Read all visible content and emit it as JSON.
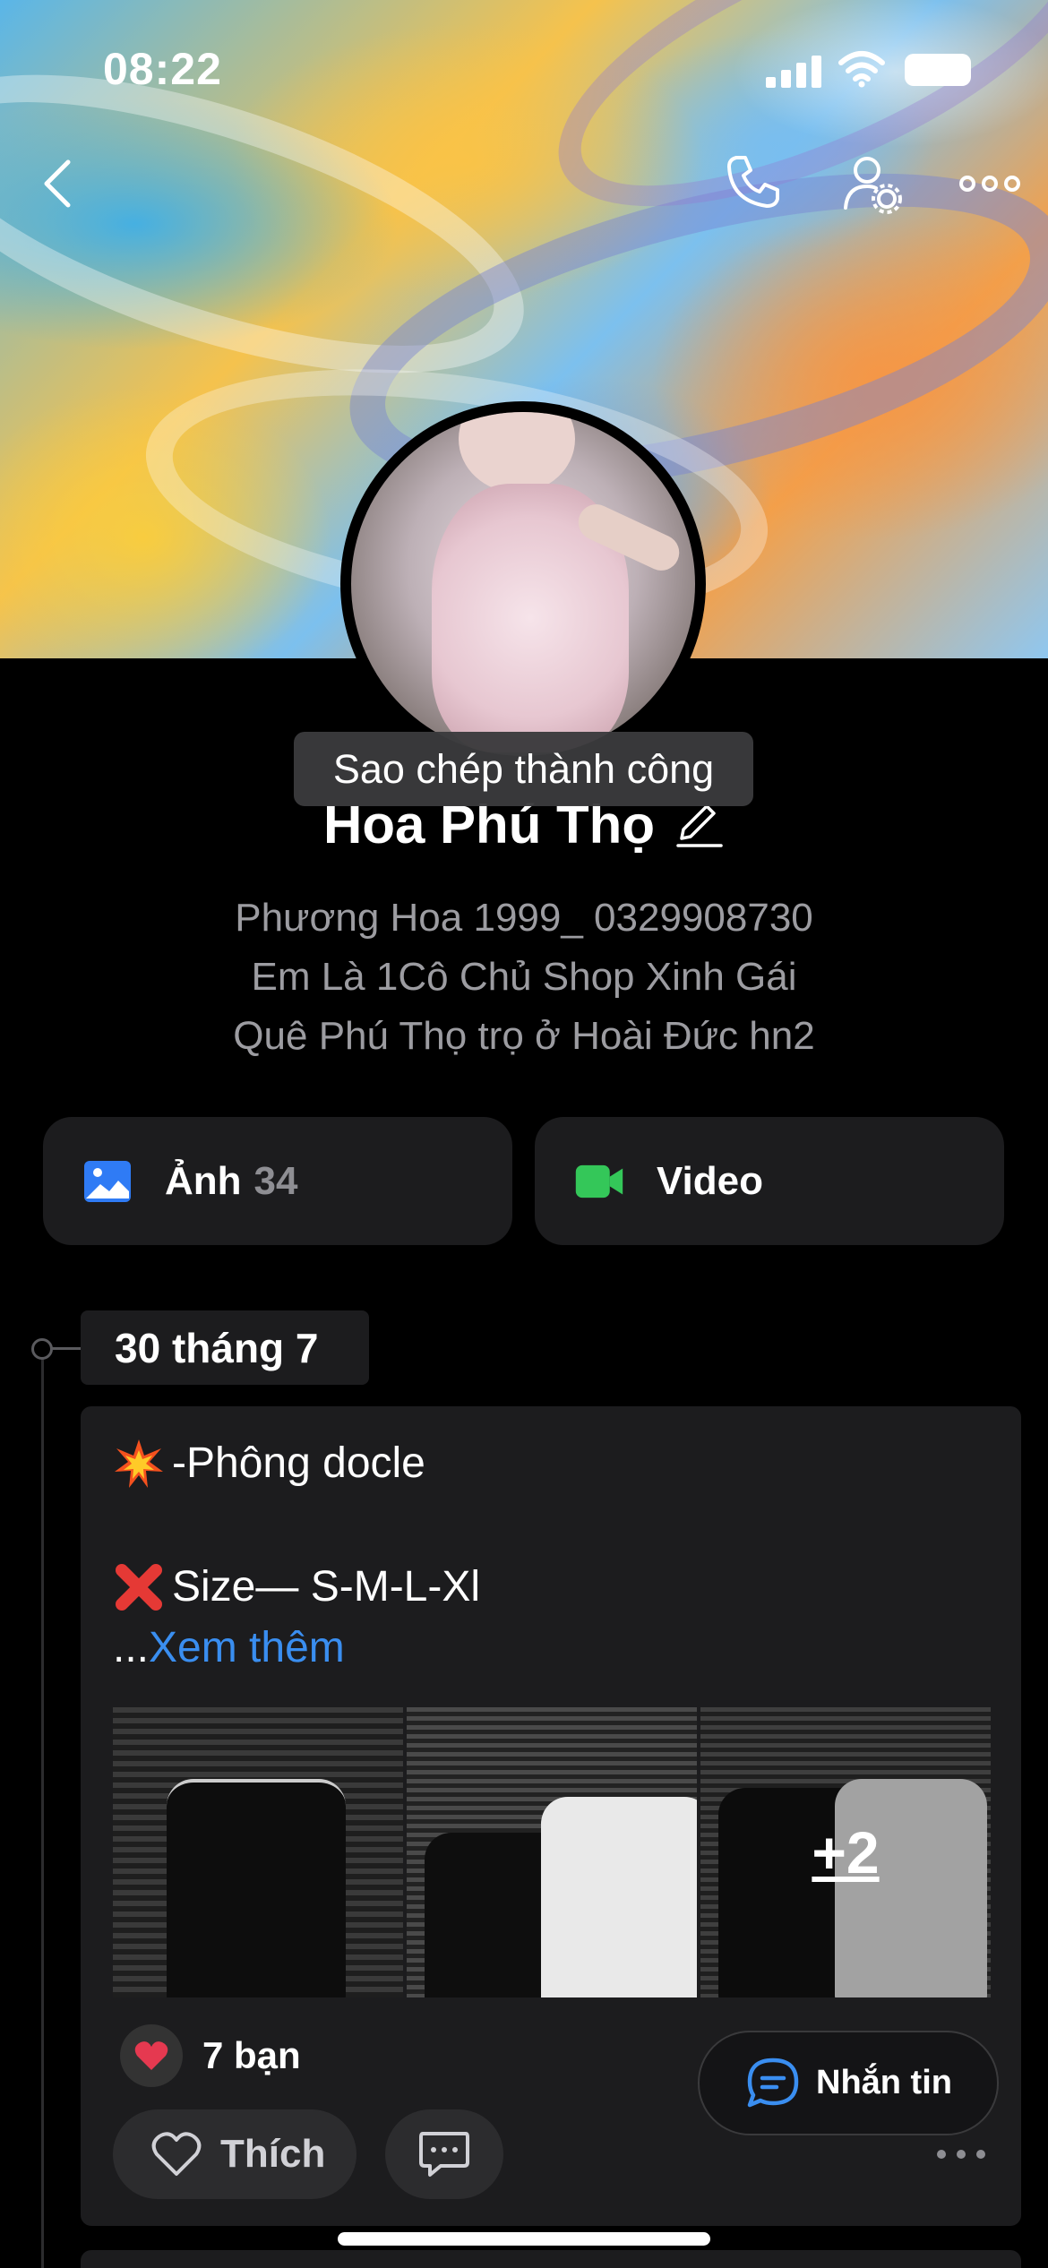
{
  "status_bar": {
    "time": "08:22"
  },
  "profile": {
    "name": "Hoa Phú Thọ",
    "bio": [
      "Phương Hoa 1999_ 0329908730",
      "Em Là 1Cô Chủ Shop Xinh Gái",
      "Quê Phú Thọ trọ ở Hoài Đức hn2"
    ]
  },
  "toast": {
    "text": "Sao chép thành công"
  },
  "media": {
    "photos_label": "Ảnh",
    "photos_count": "34",
    "videos_label": "Video"
  },
  "timeline": {
    "date": "30 tháng 7",
    "post": {
      "line1": "-Phông docle",
      "line2": "Size— S-M-L-Xl",
      "ellipsis": "...",
      "see_more": "Xem thêm",
      "extra_photos": "+2",
      "likes": "7 bạn",
      "like_label": "Thích"
    }
  },
  "message_button": {
    "label": "Nhắn tin"
  },
  "colors": {
    "accent": "#3a8ef0",
    "photo_icon": "#2f7bf5",
    "video_icon": "#34c759",
    "card": "#1c1c1e"
  }
}
